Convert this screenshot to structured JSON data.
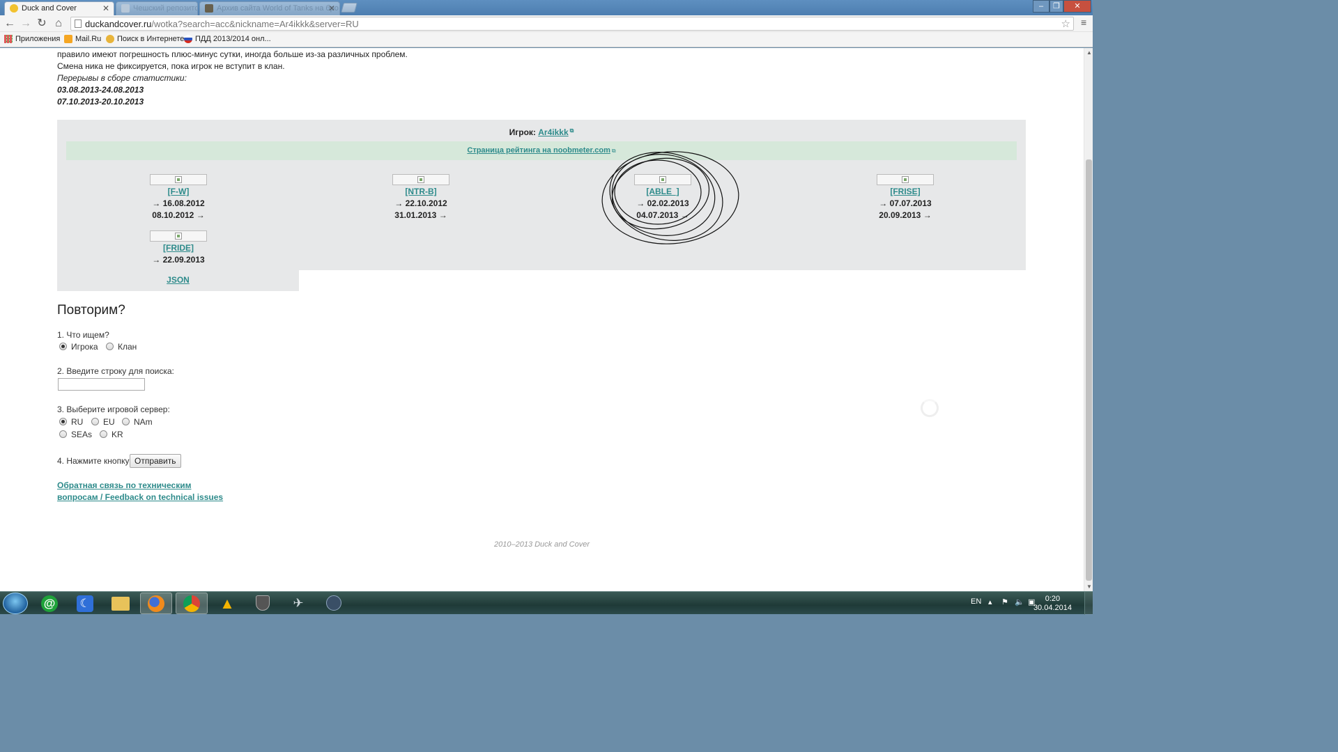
{
  "browser": {
    "tabs": [
      {
        "label": "Duck and Cover",
        "active": true
      },
      {
        "label": "Чешский репозиторий",
        "active": false
      },
      {
        "label": "Архив сайта World of Tanks на бро",
        "active": false
      }
    ],
    "url_host": "duckandcover.ru",
    "url_path": "/wotka?search=acc&nickname=Ar4ikkk&server=RU",
    "bookmarks": [
      {
        "label": "Приложения",
        "icon": "apps-grid-icon"
      },
      {
        "label": "Mail.Ru",
        "icon": "mailru-icon"
      },
      {
        "label": "Поиск в Интернете",
        "icon": "search-globe-icon"
      },
      {
        "label": "ПДД 2013/2014 онл...",
        "icon": "russia-flag-icon"
      }
    ]
  },
  "intro": {
    "line1": "правило имеют погрешность плюс-минус сутки, иногда больше из-за различных проблем.",
    "line2": "Смена ника не фиксируется, пока игрок не вступит в клан.",
    "breaks_title": "Перерывы в сборе статистики:",
    "break1": "03.08.2013-24.08.2013",
    "break2": "07.10.2013-20.10.2013"
  },
  "player": {
    "label": "Игрок:",
    "nickname": "Ar4ikkk",
    "rating_link": "Страница рейтинга на noobmeter.com",
    "clans": [
      {
        "tag": "[F-W]",
        "joined": "→ 16.08.2012",
        "left": "08.10.2012 →"
      },
      {
        "tag": "[NTR-B]",
        "joined": "→ 22.10.2012",
        "left": "31.01.2013 →"
      },
      {
        "tag": "[ABLE_]",
        "joined": "→ 02.02.2013",
        "left": "04.07.2013 →"
      },
      {
        "tag": "[FRISE]",
        "joined": "→ 07.07.2013",
        "left": "20.09.2013 →"
      },
      {
        "tag": "[FRIDE]",
        "joined": "→ 22.09.2013",
        "left": ""
      }
    ],
    "json_link": "JSON"
  },
  "form": {
    "title": "Повторим?",
    "q1": "1. Что ищем?",
    "q1_options": [
      "Игрока",
      "Клан"
    ],
    "q1_selected": "Игрока",
    "q2": "2. Введите строку для поиска:",
    "q2_value": "",
    "q3": "3. Выберите игровой сервер:",
    "q3_options": [
      "RU",
      "EU",
      "NAm",
      "SEAs",
      "KR"
    ],
    "q3_selected": "RU",
    "q4": "4. Нажмите кнопку",
    "submit_label": "Отправить"
  },
  "feedback": {
    "line1": "Обратная связь по техническим",
    "line2": "вопросам / Feedback on technical issues"
  },
  "footer": {
    "copyright": "2010–2013 Duck and Cover"
  },
  "taskbar": {
    "apps": [
      "mail-agent-icon",
      "app-moon-icon",
      "file-explorer-icon",
      "firefox-icon",
      "chrome-icon",
      "warning-triangle-icon",
      "world-of-tanks-icon",
      "world-of-warplanes-icon",
      "app-circle-icon"
    ],
    "lang": "EN",
    "time": "0:20",
    "date": "30.04.2014"
  },
  "colors": {
    "link": "#2e8b8b",
    "panel": "#e7e8e9",
    "rating_bar": "#d6e8da"
  }
}
